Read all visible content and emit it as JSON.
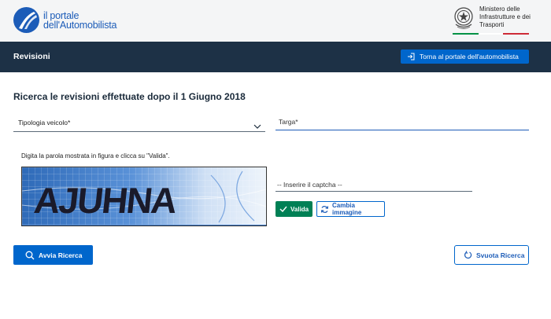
{
  "header": {
    "logo_line1": "il portale",
    "logo_line2": "dell'Automobilista",
    "ministry_line1": "Ministero delle",
    "ministry_line2": "Infrastrutture e dei",
    "ministry_line3": "Trasporti",
    "flag_colors": [
      "#009246",
      "#ffffff",
      "#ce2b37"
    ]
  },
  "navbar": {
    "title": "Revisioni",
    "back_label": "Torna al portale dell'automobilista"
  },
  "form": {
    "heading": "Ricerca le revisioni effettuate dopo il 1 Giugno 2018",
    "vehicle_type_label": "Tipologia veicolo*",
    "plate_label": "Targa*",
    "captcha_instruction": "Digita la parola mostrata in figura e clicca su \"Valida\".",
    "captcha_word": "AJUHNA",
    "captcha_placeholder": "-- Inserire il captcha --",
    "validate_label": "Valida",
    "change_image_label": "Cambia immagine",
    "search_label": "Avvia Ricerca",
    "clear_label": "Svuota Ricerca"
  },
  "colors": {
    "primary": "#0066cc",
    "navbar": "#1d3146",
    "success": "#008055"
  },
  "icons": {
    "logo": "road-logo-icon",
    "emblem": "republic-emblem-icon",
    "back": "sign-in-icon",
    "chevron": "chevron-down-icon",
    "validate": "check-icon",
    "change": "refresh-icon",
    "search": "search-icon",
    "clear": "reset-icon"
  }
}
